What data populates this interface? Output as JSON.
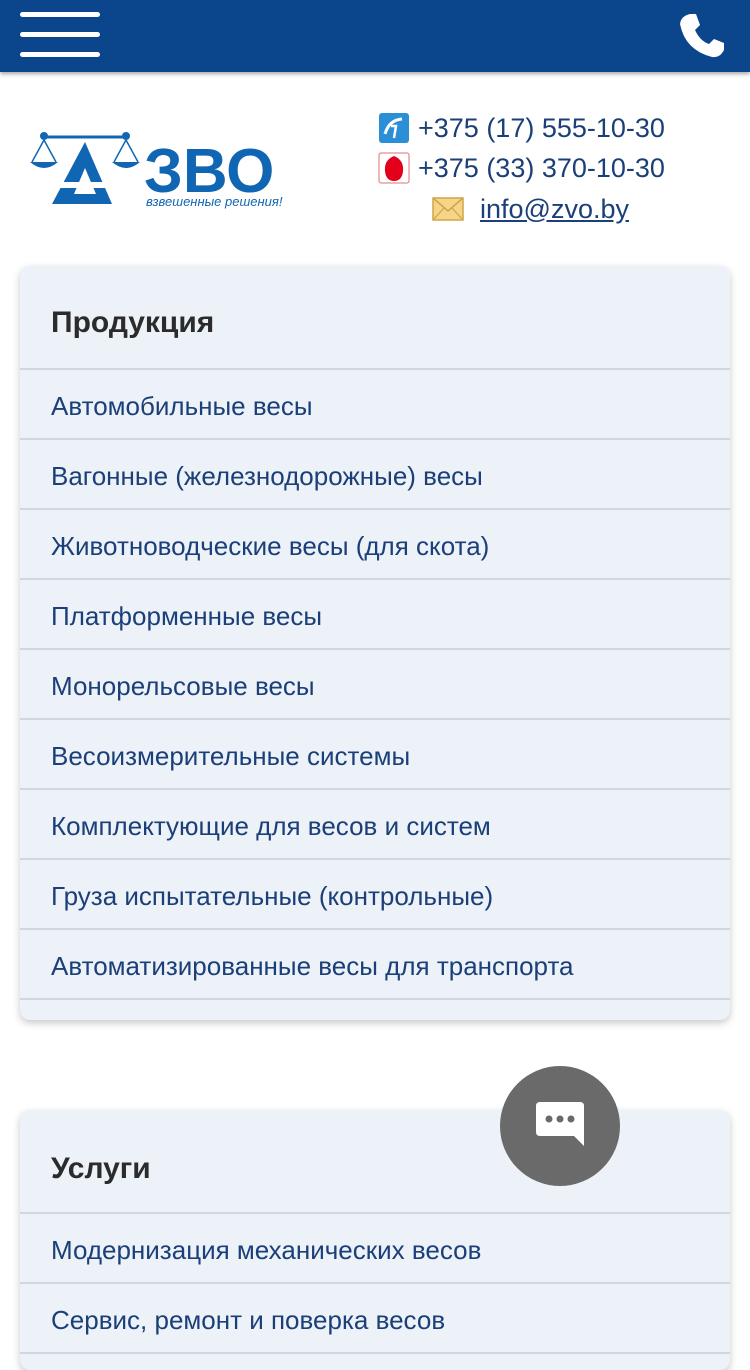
{
  "header": {
    "menu_icon": "hamburger-menu-icon",
    "phone_icon": "phone-icon",
    "background_color": "#0b468c"
  },
  "logo": {
    "brand": "ЗВО",
    "slogan": "взвешенные решения!",
    "color": "#1166b3"
  },
  "contacts": {
    "phone1": "+375 (17) 555-10-30",
    "phone1_icon": "landline-operator-icon",
    "phone2": "+375 (33) 370-10-30",
    "phone2_icon": "mobile-operator-icon",
    "email": "info@zvo.by",
    "email_icon": "envelope-icon"
  },
  "products": {
    "title": "Продукция",
    "items": [
      "Автомобильные весы",
      "Вагонные (железнодорожные) весы",
      "Животноводческие весы (для скота)",
      "Платформенные весы",
      "Монорельсовые весы",
      "Весоизмерительные системы",
      "Комплектующие для весов и систем",
      "Груза испытательные (контрольные)",
      "Автоматизированные весы для транспорта"
    ]
  },
  "services": {
    "title": "Услуги",
    "items": [
      "Модернизация механических весов",
      "Сервис, ремонт и поверка весов"
    ]
  },
  "chat_button": {
    "icon": "chat-bubble-icon",
    "color": "#6a6a6a"
  },
  "colors": {
    "link_text": "#1b3f78",
    "card_background": "#edf1f8"
  }
}
